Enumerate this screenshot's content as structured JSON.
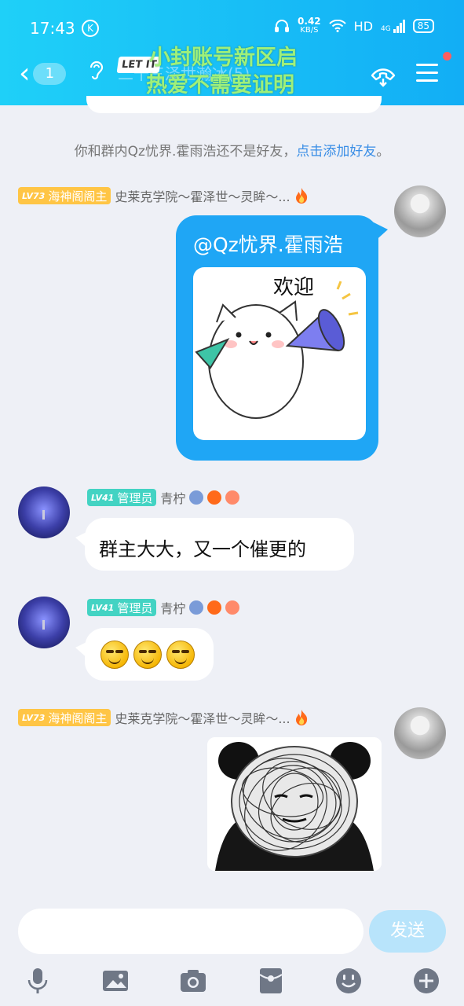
{
  "status_bar": {
    "time": "17:43",
    "k_icon": "K",
    "speed_value": "0.42",
    "speed_unit": "KB/S",
    "network": "HD",
    "signal": "4G",
    "battery": "85"
  },
  "nav": {
    "back_count": "1",
    "title": "二十三泽世瀚冰(5)"
  },
  "overlay": {
    "line1": "小封账号新区启",
    "line2": "热爱不需要证明",
    "sticker_tag": "LET IT"
  },
  "system_note": {
    "text": "你和群内Qz忧界.霍雨浩还不是好友，",
    "link": "点击添加好友",
    "tail": "。"
  },
  "messages": [
    {
      "level": "LV73",
      "title": "海神阁阁主",
      "name": "史莱克学院～霍泽世～灵眸～...",
      "text": "@Qz忧界.霍雨浩",
      "sticker_text": "欢迎"
    },
    {
      "level": "LV41",
      "title": "管理员",
      "name": "青柠",
      "text": "群主大大，又一个催更的"
    },
    {
      "level": "LV41",
      "title": "管理员",
      "name": "青柠"
    },
    {
      "level": "LV73",
      "title": "海神阁阁主",
      "name": "史莱克学院～霍泽世～灵眸～..."
    }
  ],
  "input": {
    "send_label": "发送",
    "placeholder": ""
  },
  "colors": {
    "header": "#12aef5",
    "bubble_self": "#1fa6f5",
    "gold_badge": "#ffc545",
    "teal_badge": "#43d3c3",
    "link": "#3a8ee6"
  },
  "icons": [
    "microphone-icon",
    "image-icon",
    "camera-icon",
    "red-packet-icon",
    "emoji-icon",
    "plus-icon",
    "hangup-call-icon",
    "menu-icon",
    "ear-icon",
    "fire-icon"
  ]
}
